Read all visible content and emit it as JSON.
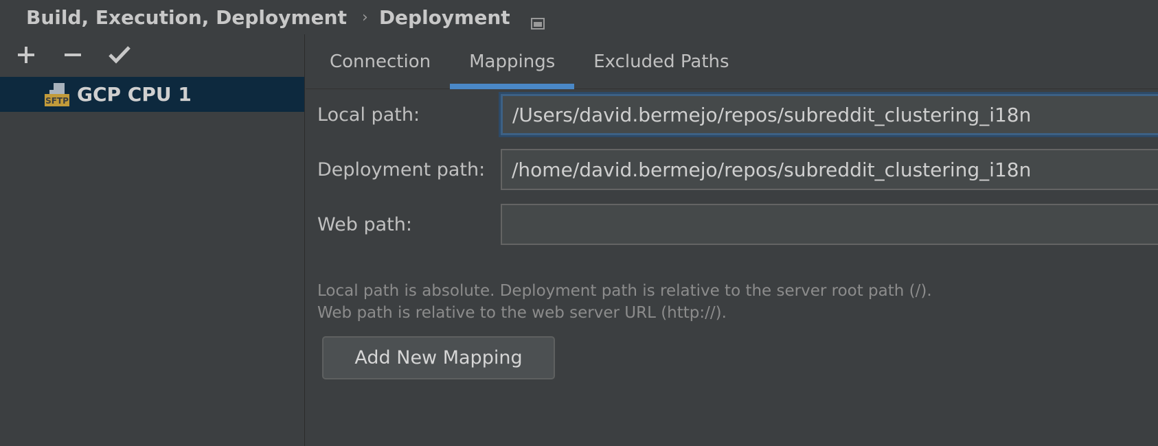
{
  "breadcrumb": {
    "parent": "Build, Execution, Deployment",
    "separator": "›",
    "current": "Deployment"
  },
  "toolbar": {
    "add_icon": "plus-icon",
    "remove_icon": "minus-icon",
    "default_icon": "check-icon"
  },
  "servers": [
    {
      "label": "GCP CPU 1",
      "icon": "sftp-icon",
      "icon_text": "SFTP"
    }
  ],
  "tabs": [
    {
      "label": "Connection"
    },
    {
      "label": "Mappings",
      "active": true
    },
    {
      "label": "Excluded Paths"
    }
  ],
  "mappings": {
    "local_path_label": "Local path:",
    "local_path_value": "/Users/david.bermejo/repos/subreddit_clustering_i18n",
    "deployment_path_label": "Deployment path:",
    "deployment_path_value": "/home/david.bermejo/repos/subreddit_clustering_i18n",
    "web_path_label": "Web path:",
    "web_path_value": "",
    "hint_line1": "Local path is absolute. Deployment path is relative to the server root path (/).",
    "hint_line2": "Web path is relative to the web server URL (http://).",
    "add_button_label": "Add New Mapping"
  },
  "colors": {
    "background": "#3c3f41",
    "selection": "#0d293e",
    "accent": "#4a88c7",
    "sftp_badge": "#c29b3a"
  }
}
